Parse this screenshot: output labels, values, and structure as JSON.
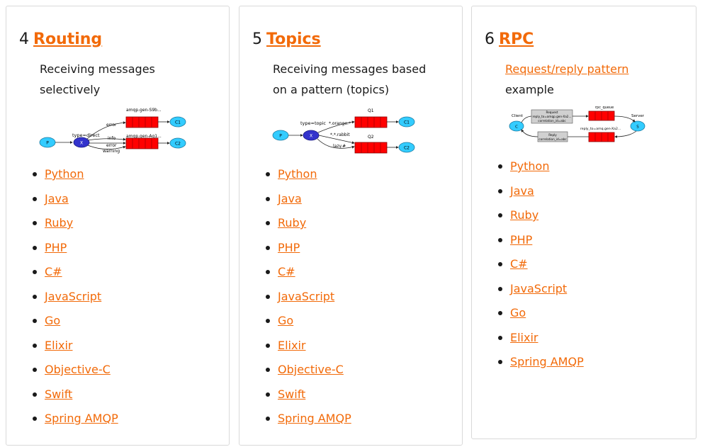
{
  "accent_color": "#f26a09",
  "cards": [
    {
      "number": "4",
      "title": "Routing",
      "desc_line1": "Receiving messages",
      "desc_line2": "selectively",
      "diagram": {
        "exchange_type": "type=direct",
        "producer": "P",
        "exchange": "X",
        "queue1": "amqp.gen-S9b...",
        "queue2": "amqp.gen-Ag1...",
        "key1": "error",
        "key2": "info",
        "key3": "error",
        "key4": "warning",
        "consumer1": "C1",
        "consumer2": "C2"
      },
      "languages": [
        "Python",
        "Java",
        "Ruby",
        "PHP",
        "C#",
        "JavaScript",
        "Go",
        "Elixir",
        "Objective-C",
        "Swift",
        "Spring AMQP"
      ]
    },
    {
      "number": "5",
      "title": "Topics",
      "desc_line1": "Receiving messages based",
      "desc_line2": "on a pattern (topics)",
      "diagram": {
        "exchange_type": "type=topic",
        "producer": "P",
        "exchange": "X",
        "queue1": "Q1",
        "queue2": "Q2",
        "key1": "*.orange.*",
        "key2": "*.*.rabbit",
        "key3": "lazy.#",
        "consumer1": "C1",
        "consumer2": "C2"
      },
      "languages": [
        "Python",
        "Java",
        "Ruby",
        "PHP",
        "C#",
        "JavaScript",
        "Go",
        "Elixir",
        "Objective-C",
        "Swift",
        "Spring AMQP"
      ]
    },
    {
      "number": "6",
      "title": "RPC",
      "desc_link": "Request/reply pattern",
      "desc_line2": "example",
      "diagram": {
        "client": "Client",
        "client_node": "C",
        "server": "Server",
        "server_node": "S",
        "rpc_queue": "rpc_queue",
        "reply_queue": "reply_to=amq.gen-Xa2...",
        "request_line1": "Request",
        "request_line2": "reply_to=amqp.gen-Xa2...",
        "request_line3": "correlation_id=abc",
        "reply_line1": "Reply",
        "reply_line2": "correlation_id=abc"
      },
      "languages": [
        "Python",
        "Java",
        "Ruby",
        "PHP",
        "C#",
        "JavaScript",
        "Go",
        "Elixir",
        "Spring AMQP"
      ]
    }
  ]
}
